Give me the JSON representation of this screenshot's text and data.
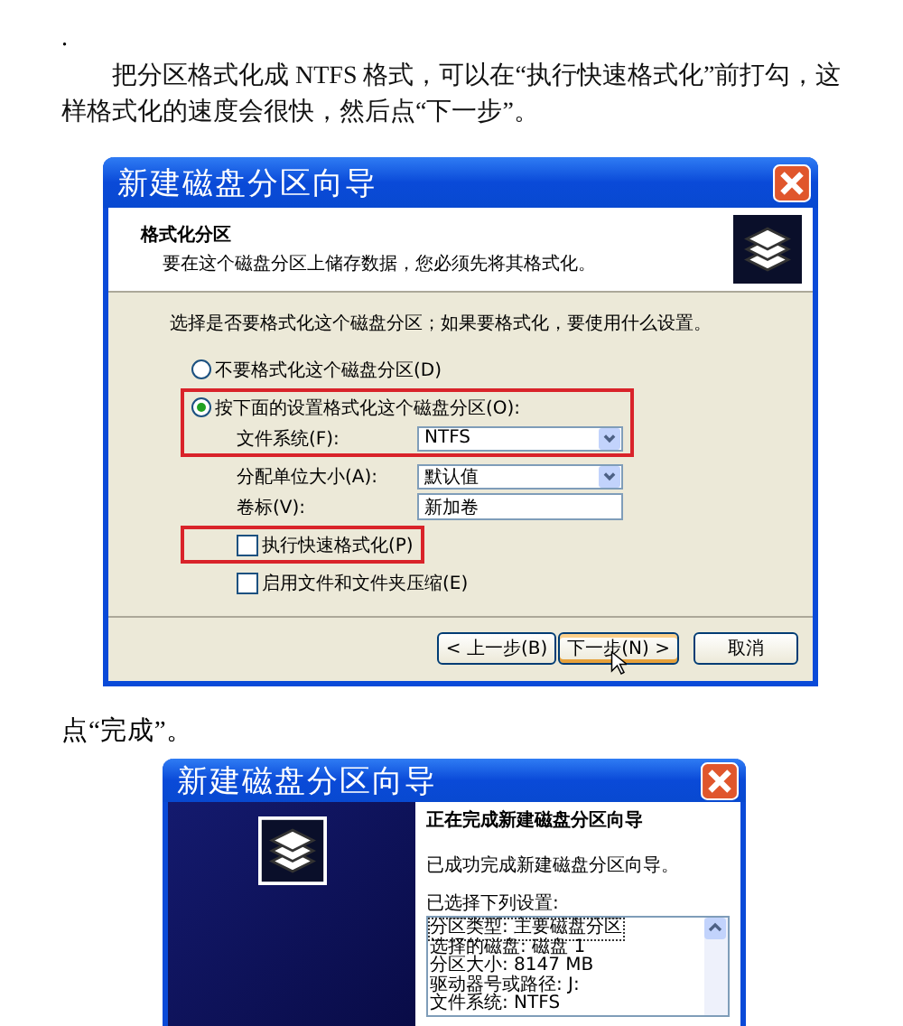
{
  "intro": {
    "marker": ".",
    "paragraph": "把分区格式化成 NTFS 格式，可以在“执行快速格式化”前打勾，这样格式化的速度会很快，然后点“下一步”。"
  },
  "dialog1": {
    "title": "新建磁盘分区向导",
    "header_title": "格式化分区",
    "header_subtitle": "要在这个磁盘分区上储存数据，您必须先将其格式化。",
    "prompt": "选择是否要格式化这个磁盘分区；如果要格式化，要使用什么设置。",
    "rows": [
      {
        "kind": "radio",
        "label": "不要格式化这个磁盘分区(D)",
        "selected": false,
        "highlighted": false
      },
      {
        "kind": "radio",
        "label": "按下面的设置格式化这个磁盘分区(O):",
        "selected": true,
        "highlighted": true
      },
      {
        "kind": "dropdown",
        "label": "文件系统(F):",
        "value": "NTFS",
        "highlighted": true
      },
      {
        "kind": "dropdown",
        "label": "分配单位大小(A):",
        "value": "默认值",
        "highlighted": false
      },
      {
        "kind": "text",
        "label": "卷标(V):",
        "value": "新加卷",
        "highlighted": false
      },
      {
        "kind": "checkbox",
        "label": "执行快速格式化(P)",
        "checked": false,
        "highlighted": true
      },
      {
        "kind": "checkbox",
        "label": "启用文件和文件夹压缩(E)",
        "checked": false,
        "highlighted": false
      }
    ],
    "buttons": [
      {
        "label": "< 上一步(B)",
        "focused": false
      },
      {
        "label": "下一步(N) >",
        "focused": true
      },
      {
        "label": "取消",
        "focused": false
      }
    ]
  },
  "caption": "点“完成”。",
  "dialog2": {
    "title": "新建磁盘分区向导",
    "heading": "正在完成新建磁盘分区向导",
    "message": "已成功完成新建磁盘分区向导。",
    "list_label": "已选择下列设置:",
    "settings": [
      {
        "text": "分区类型: 主要磁盘分区",
        "selected": true
      },
      {
        "text": "选择的磁盘: 磁盘 1",
        "selected": false
      },
      {
        "text": "分区大小: 8147 MB",
        "selected": false
      },
      {
        "text": "驱动器号或路径: J:",
        "selected": false
      },
      {
        "text": "文件系统: NTFS",
        "selected": false
      }
    ]
  }
}
